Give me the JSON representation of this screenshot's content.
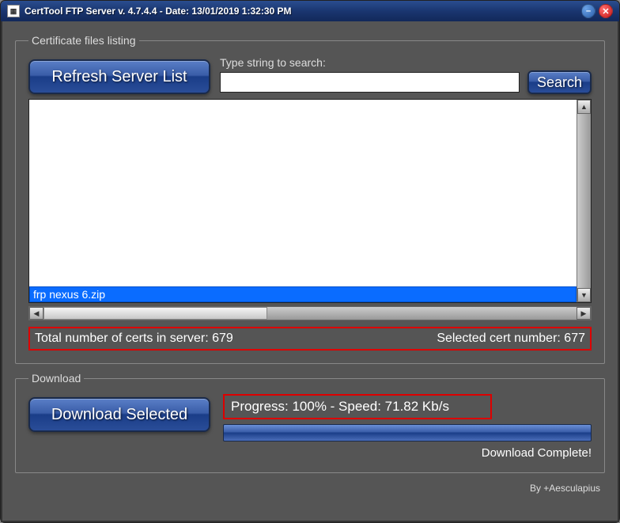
{
  "window": {
    "title": "CertTool FTP Server v. 4.7.4.4 - Date: 13/01/2019 1:32:30 PM"
  },
  "listing": {
    "legend": "Certificate files listing",
    "refresh_label": "Refresh Server List",
    "search_label": "Type string to search:",
    "search_value": "",
    "search_btn": "Search",
    "selected_file": "frp nexus 6.zip",
    "total_label": "Total number of certs in server: 679",
    "selected_label": "Selected cert number: 677"
  },
  "download": {
    "legend": "Download",
    "btn_label": "Download Selected",
    "progress_text": "Progress: 100% - Speed: 71.82 Kb/s",
    "progress_pct": 100,
    "complete_text": "Download Complete!"
  },
  "footer": {
    "credit": "By +Aesculapius"
  }
}
